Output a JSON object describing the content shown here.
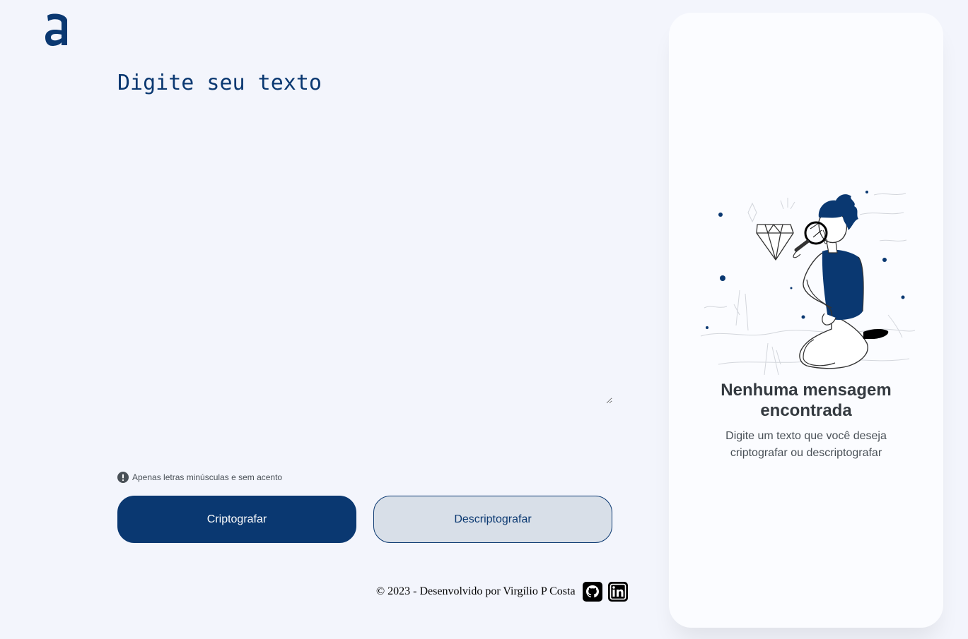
{
  "brand": {
    "logo_icon": "alura-a-logo-icon",
    "primary_color": "#0a3871",
    "background_color": "#f3f5fc"
  },
  "editor": {
    "placeholder": "Digite seu texto",
    "value": ""
  },
  "hint": {
    "icon": "exclamation-circle-icon",
    "text": "Apenas letras minúsculas e sem acento"
  },
  "buttons": {
    "encrypt_label": "Criptografar",
    "decrypt_label": "Descriptografar"
  },
  "footer": {
    "text": "© 2023 - Desenvolvido por Virgílio P Costa",
    "icons": [
      "github-icon",
      "linkedin-icon"
    ]
  },
  "output_panel": {
    "illustration": "person-with-magnifying-glass-illustration",
    "title": "Nenhuma mensagem encontrada",
    "subtitle": "Digite um texto que você deseja criptografar ou descriptografar"
  }
}
